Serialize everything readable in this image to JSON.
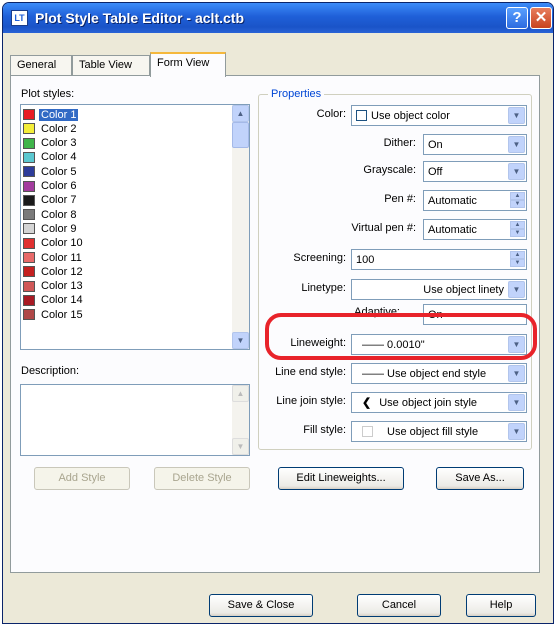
{
  "window": {
    "title": "Plot Style Table Editor - aclt.ctb",
    "help_glyph": "?",
    "close_glyph": "✕",
    "icon_glyph": "LT"
  },
  "tabs": [
    "General",
    "Table View",
    "Form View"
  ],
  "plot_styles": {
    "label": "Plot styles:",
    "items": [
      {
        "label": "Color 1",
        "color": "#e81c24"
      },
      {
        "label": "Color 2",
        "color": "#f4ee3a"
      },
      {
        "label": "Color 3",
        "color": "#3fb54a"
      },
      {
        "label": "Color 4",
        "color": "#5bc8d0"
      },
      {
        "label": "Color 5",
        "color": "#2d3c9a"
      },
      {
        "label": "Color 6",
        "color": "#a33c9e"
      },
      {
        "label": "Color 7",
        "color": "#1a1a1a"
      },
      {
        "label": "Color 8",
        "color": "#7a7a7a"
      },
      {
        "label": "Color 9",
        "color": "#d4d4d4"
      },
      {
        "label": "Color 10",
        "color": "#e03030"
      },
      {
        "label": "Color 11",
        "color": "#e86a6a"
      },
      {
        "label": "Color 12",
        "color": "#c42020"
      },
      {
        "label": "Color 13",
        "color": "#d05858"
      },
      {
        "label": "Color 14",
        "color": "#a81a24"
      },
      {
        "label": "Color 15",
        "color": "#b04848"
      }
    ],
    "selected_index": 0
  },
  "description": {
    "label": "Description:"
  },
  "buttons": {
    "add_style": "Add Style",
    "delete_style": "Delete Style",
    "edit_lineweights": "Edit Lineweights...",
    "save_as": "Save As...",
    "save_close": "Save & Close",
    "cancel": "Cancel",
    "help": "Help"
  },
  "properties": {
    "title": "Properties",
    "color": {
      "label": "Color:",
      "value": "Use object color"
    },
    "dither": {
      "label": "Dither:",
      "value": "On"
    },
    "grayscale": {
      "label": "Grayscale:",
      "value": "Off"
    },
    "pen": {
      "label": "Pen #:",
      "value": "Automatic"
    },
    "virtual_pen": {
      "label": "Virtual pen #:",
      "value": "Automatic"
    },
    "screening": {
      "label": "Screening:",
      "value": "100"
    },
    "linetype": {
      "label": "Linetype:",
      "value": "Use object linety"
    },
    "adaptive": {
      "label": "Adaptive:",
      "value": "On"
    },
    "lineweight": {
      "label": "Lineweight:",
      "value": "—— 0.0010\""
    },
    "line_end_style": {
      "label": "Line end style:",
      "value": "—— Use object end style"
    },
    "line_join_style": {
      "label": "Line join style:",
      "value": "Use object join style"
    },
    "fill_style": {
      "label": "Fill style:",
      "value": "Use object fill style"
    }
  }
}
